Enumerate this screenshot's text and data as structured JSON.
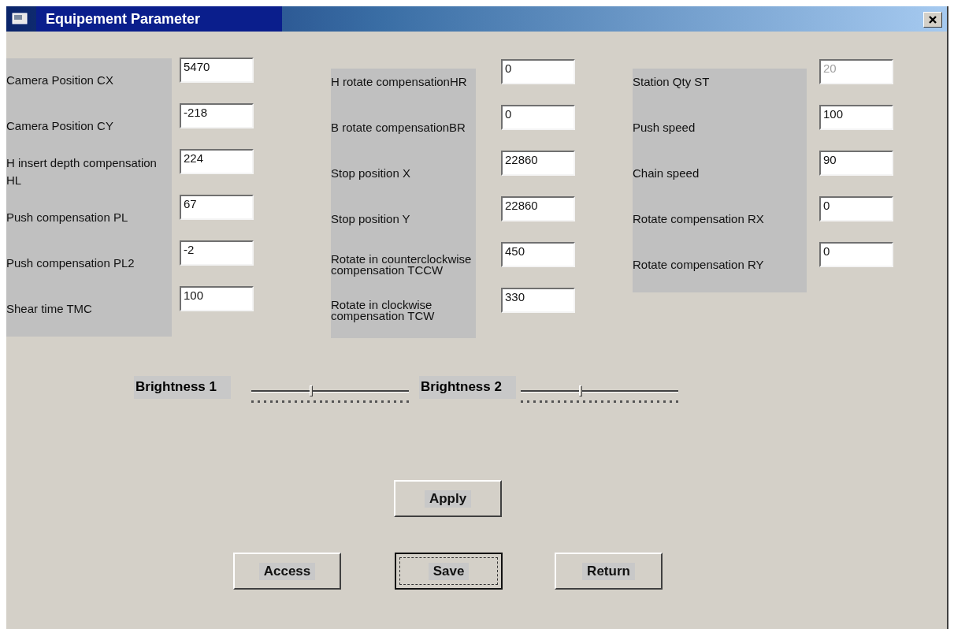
{
  "window": {
    "title": "Equipement Parameter"
  },
  "columns": [
    {
      "fields": [
        {
          "label": "Camera Position CX",
          "value": "5470",
          "disabled": false
        },
        {
          "label": "Camera Position CY",
          "value": "-218",
          "disabled": false
        },
        {
          "label": "H insert depth compensation HL",
          "value": "224",
          "disabled": false
        },
        {
          "label": "Push compensation PL",
          "value": "67",
          "disabled": false
        },
        {
          "label": "Push compensation PL2",
          "value": "-2",
          "disabled": false
        },
        {
          "label": "Shear time TMC",
          "value": "100",
          "disabled": false
        }
      ]
    },
    {
      "fields": [
        {
          "label": "H rotate compensationHR",
          "value": "0",
          "disabled": false
        },
        {
          "label": "B rotate compensationBR",
          "value": "0",
          "disabled": false
        },
        {
          "label": "Stop position X",
          "value": "22860",
          "disabled": false
        },
        {
          "label": "Stop position Y",
          "value": "22860",
          "disabled": false
        },
        {
          "label": "Rotate in counterclockwise compensation TCCW",
          "value": "450",
          "disabled": false
        },
        {
          "label": "Rotate in clockwise compensation TCW",
          "value": "330",
          "disabled": false
        }
      ]
    },
    {
      "fields": [
        {
          "label": "Station Qty ST",
          "value": "20",
          "disabled": true
        },
        {
          "label": "Push speed",
          "value": "100",
          "disabled": false
        },
        {
          "label": "Chain speed",
          "value": "90",
          "disabled": false
        },
        {
          "label": "Rotate  compensation RX",
          "value": "0",
          "disabled": false
        },
        {
          "label": "Rotate  compensation RY",
          "value": "0",
          "disabled": false
        }
      ]
    }
  ],
  "sliders": [
    {
      "label": "Brightness 1",
      "level": 0.38
    },
    {
      "label": "Brightness 2",
      "level": 0.38
    }
  ],
  "apply_button": {
    "label": "Apply",
    "default": false
  },
  "buttons": [
    {
      "label": "Access",
      "default": false
    },
    {
      "label": "Save",
      "default": true
    },
    {
      "label": "Return",
      "default": false
    }
  ]
}
